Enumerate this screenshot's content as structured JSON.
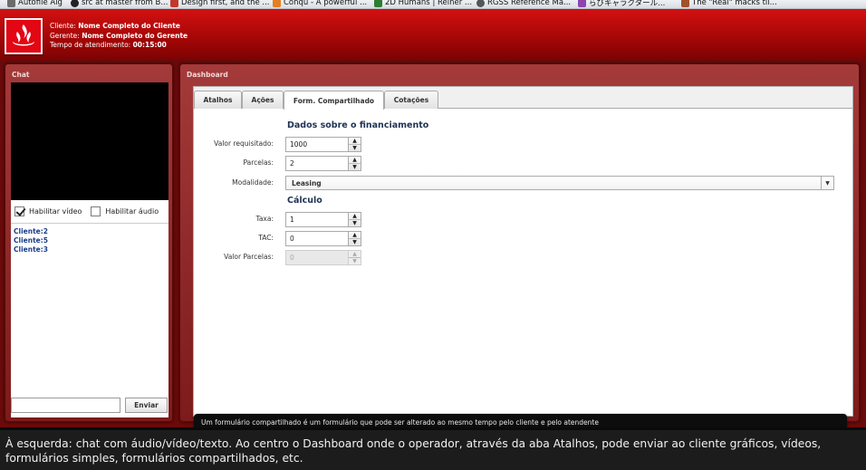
{
  "bookmarks": [
    {
      "label": "Autofile Alg",
      "icon": "page-icon",
      "color": "#6b6b6b"
    },
    {
      "label": "src at master from B...",
      "icon": "github-icon",
      "color": "#222222"
    },
    {
      "label": "Design first, and the ...",
      "icon": "bookmark-icon",
      "color": "#c0392b"
    },
    {
      "label": "Conqu - A powerful ...",
      "icon": "bookmark-icon",
      "color": "#e67e22"
    },
    {
      "label": "2D Humans | Reiner ...",
      "icon": "bookmark-icon",
      "color": "#2e7d32"
    },
    {
      "label": "RGSS Reference Ma...",
      "icon": "globe-icon",
      "color": "#555555"
    },
    {
      "label": "らびキャラクタール...",
      "icon": "bookmark-icon",
      "color": "#8e44ad"
    },
    {
      "label": "The \"Real\" macks til...",
      "icon": "bookmark-icon",
      "color": "#a0522d"
    }
  ],
  "header": {
    "cliente_label": "Cliente:",
    "cliente_value": "Nome Completo do Cliente",
    "gerente_label": "Gerente:",
    "gerente_value": "Nome Completo do Gerente",
    "tempo_label": "Tempo de atendimento:",
    "tempo_value": "00:15:00",
    "brand_color": "#cc0000"
  },
  "chat": {
    "title": "Chat",
    "video_option": "Habilitar vídeo",
    "video_checked": true,
    "audio_option": "Habilitar áudio",
    "audio_checked": false,
    "clients": [
      "Cliente:2",
      "Cliente:5",
      "Cliente:3"
    ],
    "input_value": "",
    "send_label": "Enviar"
  },
  "dashboard": {
    "title": "Dashboard",
    "tabs": [
      {
        "label": "Atalhos",
        "active": false
      },
      {
        "label": "Ações",
        "active": false
      },
      {
        "label": "Form. Compartilhado",
        "active": true
      },
      {
        "label": "Cotações",
        "active": false
      }
    ],
    "form": {
      "section_financing": "Dados sobre o financiamento",
      "valor_requisitado_label": "Valor requisitado:",
      "valor_requisitado_value": "1000",
      "parcelas_label": "Parcelas:",
      "parcelas_value": "2",
      "modalidade_label": "Modalidade:",
      "modalidade_value": "Leasing",
      "section_calculo": "Cálculo",
      "taxa_label": "Taxa:",
      "taxa_value": "1",
      "tac_label": "TAC:",
      "tac_value": "0",
      "valor_parcelas_label": "Valor Parcelas:",
      "valor_parcelas_value": "0"
    },
    "info_text": "Um formulário compartilhado é um formulário que pode ser alterado ao mesmo tempo pelo cliente e pelo atendente"
  },
  "caption": "À esquerda: chat com áudio/vídeo/texto. Ao centro o Dashboard onde o operador, através da aba Atalhos, pode enviar ao cliente gráficos, vídeos, formulários simples, formulários compartilhados, etc."
}
